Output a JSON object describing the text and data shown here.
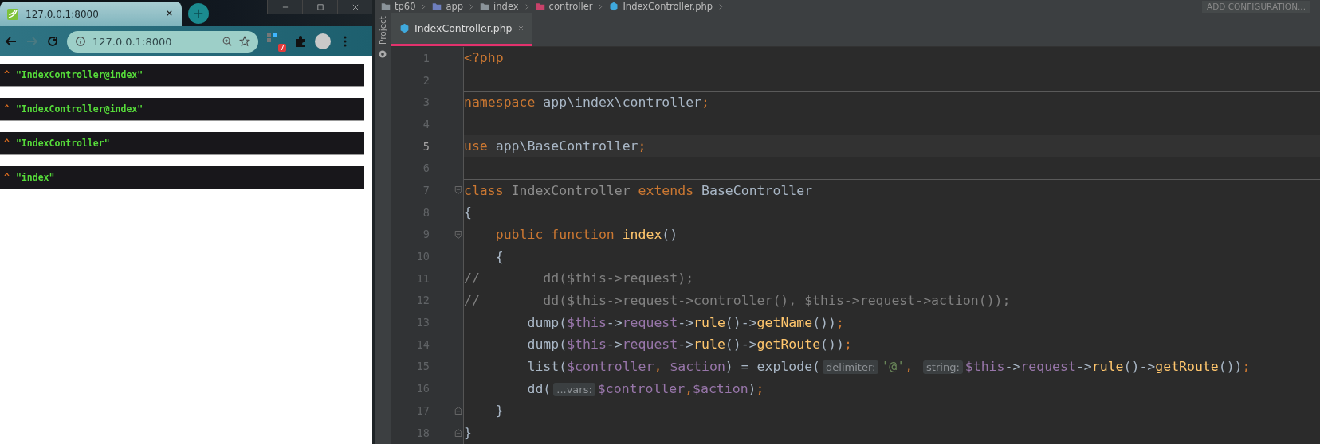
{
  "browser": {
    "tab_title": "127.0.0.1:8000",
    "address": "127.0.0.1:8000",
    "extension_badge": "7",
    "dumps": [
      {
        "caret": "^",
        "value": "\"IndexController@index\""
      },
      {
        "caret": "^",
        "value": "\"IndexController@index\""
      },
      {
        "caret": "^",
        "value": "\"IndexController\""
      },
      {
        "caret": "^",
        "value": "\"index\""
      }
    ]
  },
  "ide": {
    "breadcrumbs": [
      {
        "label": "tp60",
        "kind": "folder"
      },
      {
        "label": "app",
        "kind": "module"
      },
      {
        "label": "index",
        "kind": "folder"
      },
      {
        "label": "controller",
        "kind": "package"
      },
      {
        "label": "IndexController.php",
        "kind": "php"
      }
    ],
    "run_config": "ADD CONFIGURATION...",
    "side_tab": "Project",
    "tabs": [
      {
        "label": "IndexController.php",
        "selected": true
      }
    ],
    "lines": [
      {
        "number": "1",
        "current": false,
        "separator": false,
        "tokens": [
          {
            "kind": "keyword",
            "text": "<?php"
          }
        ]
      },
      {
        "number": "2",
        "current": false,
        "separator": false
      },
      {
        "number": "3",
        "current": false,
        "separator": true,
        "tokens": [
          {
            "kind": "keyword",
            "text": "namespace"
          },
          {
            "kind": "plain",
            "text": " app\\index\\controller"
          },
          {
            "kind": "punct",
            "text": ";"
          }
        ]
      },
      {
        "number": "4",
        "current": false,
        "separator": false
      },
      {
        "number": "5",
        "current": true,
        "separator": false,
        "tokens": [
          {
            "kind": "keyword",
            "text": "use"
          },
          {
            "kind": "plain",
            "text": " app\\BaseController"
          },
          {
            "kind": "punct",
            "text": ";"
          }
        ]
      },
      {
        "number": "6",
        "current": false,
        "separator": false
      },
      {
        "number": "7",
        "current": false,
        "separator": true,
        "fold_open": true,
        "tokens": [
          {
            "kind": "keyword",
            "text": "class"
          },
          {
            "kind": "unused",
            "text": " IndexController"
          },
          {
            "kind": "keyword",
            "text": " extends"
          },
          {
            "kind": "plain",
            "text": " BaseController"
          }
        ]
      },
      {
        "number": "8",
        "current": false,
        "separator": false,
        "tokens": [
          {
            "kind": "plain",
            "text": "{"
          }
        ]
      },
      {
        "number": "9",
        "current": false,
        "separator": false,
        "fold_open": true,
        "tokens": [
          {
            "kind": "keyword",
            "text": "    public function"
          },
          {
            "kind": "method",
            "text": " index"
          },
          {
            "kind": "plain",
            "text": "()"
          }
        ]
      },
      {
        "number": "10",
        "current": false,
        "separator": false,
        "tokens": [
          {
            "kind": "plain",
            "text": "    {"
          }
        ]
      },
      {
        "number": "11",
        "current": false,
        "separator": false,
        "tokens": [
          {
            "kind": "comment",
            "text": "//        dd($this->request);"
          }
        ]
      },
      {
        "number": "12",
        "current": false,
        "separator": false,
        "tokens": [
          {
            "kind": "comment",
            "text": "//        dd($this->request->controller(), $this->request->action());"
          }
        ]
      },
      {
        "number": "13",
        "current": false,
        "separator": false,
        "tokens": [
          {
            "kind": "plain",
            "text": "        dump("
          },
          {
            "kind": "variable",
            "text": "$this"
          },
          {
            "kind": "plain",
            "text": "->"
          },
          {
            "kind": "variable",
            "text": "request"
          },
          {
            "kind": "plain",
            "text": "->"
          },
          {
            "kind": "method",
            "text": "rule"
          },
          {
            "kind": "plain",
            "text": "()->"
          },
          {
            "kind": "method",
            "text": "getName"
          },
          {
            "kind": "plain",
            "text": "())"
          },
          {
            "kind": "punct",
            "text": ";"
          }
        ]
      },
      {
        "number": "14",
        "current": false,
        "separator": false,
        "tokens": [
          {
            "kind": "plain",
            "text": "        dump("
          },
          {
            "kind": "variable",
            "text": "$this"
          },
          {
            "kind": "plain",
            "text": "->"
          },
          {
            "kind": "variable",
            "text": "request"
          },
          {
            "kind": "plain",
            "text": "->"
          },
          {
            "kind": "method",
            "text": "rule"
          },
          {
            "kind": "plain",
            "text": "()->"
          },
          {
            "kind": "method",
            "text": "getRoute"
          },
          {
            "kind": "plain",
            "text": "())"
          },
          {
            "kind": "punct",
            "text": ";"
          }
        ]
      },
      {
        "number": "15",
        "current": false,
        "separator": false,
        "tokens": [
          {
            "kind": "plain",
            "text": "        list("
          },
          {
            "kind": "variable",
            "text": "$controller"
          },
          {
            "kind": "punct",
            "text": ","
          },
          {
            "kind": "variable",
            "text": " $action"
          },
          {
            "kind": "plain",
            "text": ") = explode("
          },
          {
            "kind": "hint",
            "text": "delimiter:"
          },
          {
            "kind": "string",
            "text": "'@'"
          },
          {
            "kind": "punct",
            "text": ", "
          },
          {
            "kind": "hint",
            "text": "string:"
          },
          {
            "kind": "variable",
            "text": "$this"
          },
          {
            "kind": "plain",
            "text": "->"
          },
          {
            "kind": "variable",
            "text": "request"
          },
          {
            "kind": "plain",
            "text": "->"
          },
          {
            "kind": "method",
            "text": "rule"
          },
          {
            "kind": "plain",
            "text": "()->"
          },
          {
            "kind": "method",
            "text": "getRoute"
          },
          {
            "kind": "plain",
            "text": "())"
          },
          {
            "kind": "punct",
            "text": ";"
          }
        ]
      },
      {
        "number": "16",
        "current": false,
        "separator": false,
        "tokens": [
          {
            "kind": "plain",
            "text": "        dd("
          },
          {
            "kind": "hint",
            "text": "...vars:"
          },
          {
            "kind": "variable",
            "text": "$controller"
          },
          {
            "kind": "punct",
            "text": ","
          },
          {
            "kind": "variable",
            "text": "$action"
          },
          {
            "kind": "plain",
            "text": ")"
          },
          {
            "kind": "punct",
            "text": ";"
          }
        ]
      },
      {
        "number": "17",
        "current": false,
        "separator": false,
        "fold_close": true,
        "tokens": [
          {
            "kind": "plain",
            "text": "    }"
          }
        ]
      },
      {
        "number": "18",
        "current": false,
        "separator": false,
        "fold_close": true,
        "tokens": [
          {
            "kind": "plain",
            "text": "}"
          }
        ]
      }
    ]
  }
}
